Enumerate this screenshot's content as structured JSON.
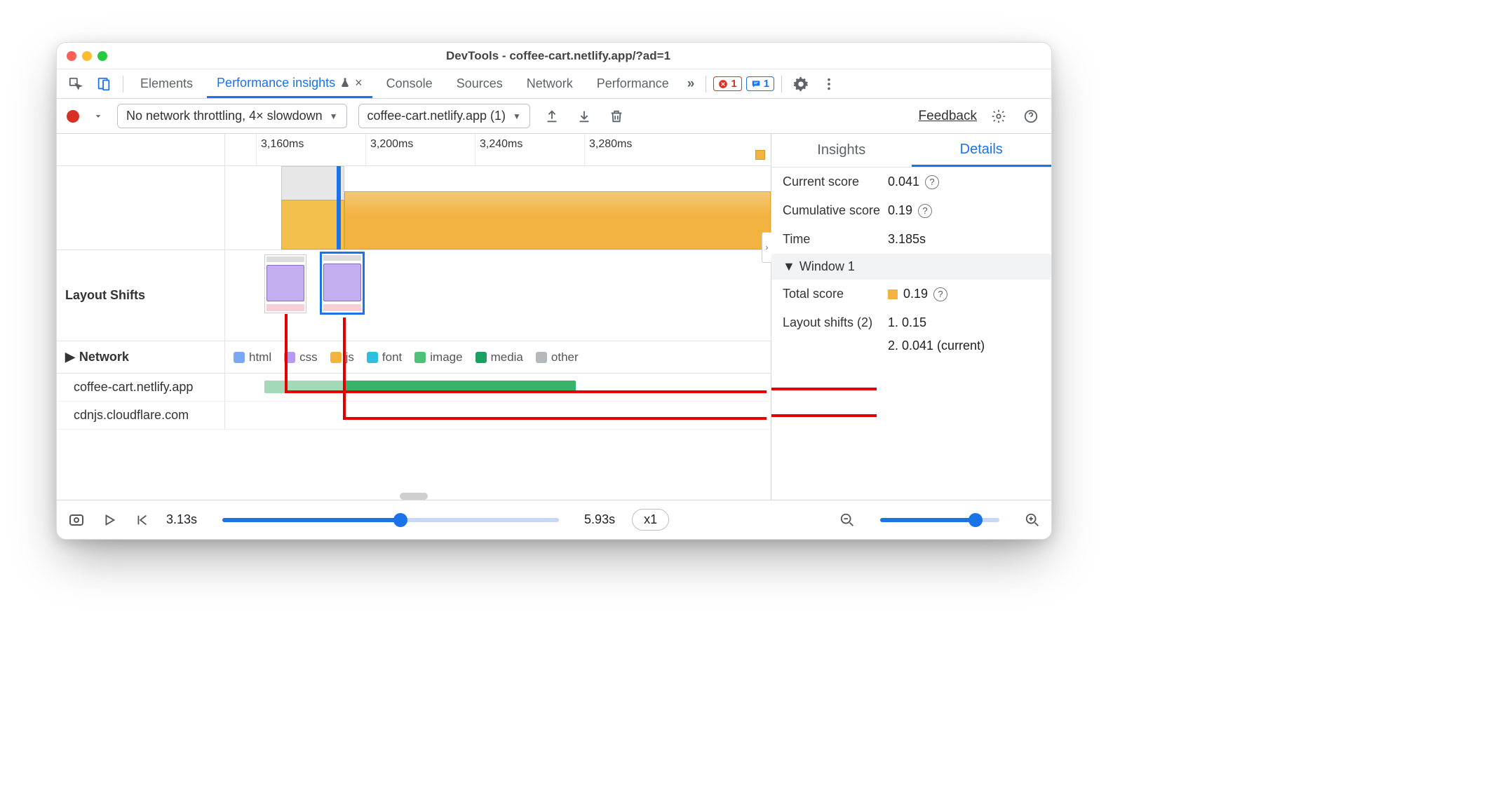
{
  "window_title": "DevTools - coffee-cart.netlify.app/?ad=1",
  "tabs": {
    "elements": "Elements",
    "perf_insights": "Performance insights",
    "console": "Console",
    "sources": "Sources",
    "network": "Network",
    "performance": "Performance"
  },
  "errors_count": "1",
  "messages_count": "1",
  "toolbar": {
    "throttling": "No network throttling, 4× slowdown",
    "recording": "coffee-cart.netlify.app (1)",
    "feedback": "Feedback"
  },
  "timeline": {
    "ticks": [
      "3,160ms",
      "3,200ms",
      "3,240ms",
      "3,280ms"
    ],
    "row_layout_shifts": "Layout Shifts",
    "row_network": "Network",
    "legend_html": "html",
    "legend_css": "css",
    "legend_js": "js",
    "legend_font": "font",
    "legend_image": "image",
    "legend_media": "media",
    "legend_other": "other",
    "colors": {
      "html": "#7aa8f3",
      "css": "#b99af2",
      "js": "#f3b341",
      "font": "#2bc0de",
      "image": "#4bc278",
      "media": "#1da061",
      "other": "#b6b9bc"
    },
    "hosts": {
      "h1": "coffee-cart.netlify.app",
      "h2": "cdnjs.cloudflare.com"
    }
  },
  "details": {
    "tab_insights": "Insights",
    "tab_details": "Details",
    "current_score_k": "Current score",
    "current_score_v": "0.041",
    "cumulative_score_k": "Cumulative score",
    "cumulative_score_v": "0.19",
    "time_k": "Time",
    "time_v": "3.185s",
    "window_head": "Window 1",
    "total_score_k": "Total score",
    "total_score_v": "0.19",
    "layout_shifts_k": "Layout shifts (2)",
    "shift1": "1. 0.15",
    "shift2": "2. 0.041 (current)"
  },
  "footer": {
    "start": "3.13s",
    "end": "5.93s",
    "speed": "x1"
  }
}
